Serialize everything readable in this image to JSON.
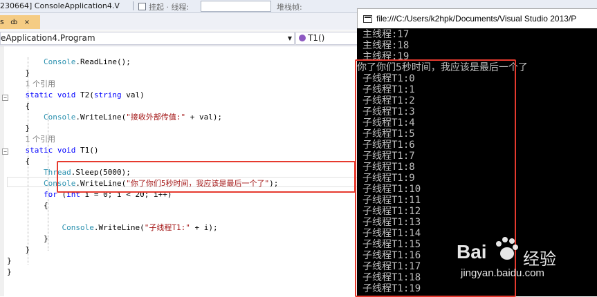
{
  "toolbar": {
    "project_combo": "230664] ConsoleApplication4.V",
    "threads_label": "挂起 · 线程:",
    "stack_frame_label": "堆栈帧:"
  },
  "tab": {
    "label": "s",
    "pin": "ȸ",
    "close": "×"
  },
  "nav": {
    "class_combo": "eApplication4.Program",
    "method_combo": "T1()"
  },
  "code": {
    "lines": [
      {
        "id": "l1",
        "indent": "        ",
        "parts": [
          [
            "ty",
            "Console"
          ],
          [
            "",
            ".ReadLine();"
          ]
        ]
      },
      {
        "id": "l2",
        "indent": "    ",
        "parts": [
          [
            "",
            "}"
          ]
        ]
      },
      {
        "id": "l3",
        "indent": "    ",
        "ref": "1 个引用"
      },
      {
        "id": "l4",
        "indent": "    ",
        "parts": [
          [
            "kw",
            "static"
          ],
          [
            "",
            " "
          ],
          [
            "kw",
            "void"
          ],
          [
            "",
            " T2("
          ],
          [
            "kw",
            "string"
          ],
          [
            "",
            " val)"
          ]
        ]
      },
      {
        "id": "l5",
        "indent": "    ",
        "parts": [
          [
            "",
            "{"
          ]
        ]
      },
      {
        "id": "l6",
        "indent": "        ",
        "parts": [
          [
            "ty",
            "Console"
          ],
          [
            "",
            ".WriteLine("
          ],
          [
            "str",
            "\"接收外部传值:\""
          ],
          [
            "",
            " + val);"
          ]
        ]
      },
      {
        "id": "l7",
        "indent": "    ",
        "parts": [
          [
            "",
            "}"
          ]
        ]
      },
      {
        "id": "l8",
        "indent": "    ",
        "ref": "1 个引用"
      },
      {
        "id": "l9",
        "indent": "    ",
        "parts": [
          [
            "kw",
            "static"
          ],
          [
            "",
            " "
          ],
          [
            "kw",
            "void"
          ],
          [
            "",
            " T1()"
          ]
        ]
      },
      {
        "id": "l10",
        "indent": "    ",
        "parts": [
          [
            "",
            "{"
          ]
        ]
      },
      {
        "id": "l11",
        "indent": "        ",
        "parts": [
          [
            "ty",
            "Thread"
          ],
          [
            "",
            ".Sleep(5000);"
          ]
        ]
      },
      {
        "id": "l12",
        "indent": "        ",
        "parts": [
          [
            "ty",
            "Console"
          ],
          [
            "",
            ".WriteLine("
          ],
          [
            "str",
            "\"你了你们5秒时间，我应该是最后一个了\""
          ],
          [
            "",
            ");"
          ]
        ]
      },
      {
        "id": "l13",
        "indent": "        ",
        "parts": [
          [
            "kw",
            "for"
          ],
          [
            "",
            " ("
          ],
          [
            "kw",
            "int"
          ],
          [
            "",
            " i = 0; i < 20; i++)"
          ]
        ]
      },
      {
        "id": "l14",
        "indent": "        ",
        "parts": [
          [
            "",
            "{"
          ]
        ]
      },
      {
        "id": "l15",
        "indent": "",
        "parts": []
      },
      {
        "id": "l16",
        "indent": "            ",
        "parts": [
          [
            "ty",
            "Console"
          ],
          [
            "",
            ".WriteLine("
          ],
          [
            "str",
            "\"子线程T1:\""
          ],
          [
            "",
            " + i);"
          ]
        ]
      },
      {
        "id": "l17",
        "indent": "        ",
        "parts": [
          [
            "",
            "}"
          ]
        ]
      },
      {
        "id": "l18",
        "indent": "    ",
        "parts": [
          [
            "",
            "}"
          ]
        ]
      },
      {
        "id": "l19",
        "indent": "",
        "parts": [
          [
            "",
            "}"
          ]
        ]
      },
      {
        "id": "l20",
        "indent": "",
        "parts": [
          [
            "",
            "}"
          ]
        ]
      }
    ]
  },
  "console": {
    "title": "file:///C:/Users/k2hpk/Documents/Visual Studio 2013/P",
    "lines": [
      "主线程:17",
      "主线程:18",
      "主线程:19",
      "你了你们5秒时间，我应该是最后一个了",
      "子线程T1:0",
      "子线程T1:1",
      "子线程T1:2",
      "子线程T1:3",
      "子线程T1:4",
      "子线程T1:5",
      "子线程T1:6",
      "子线程T1:7",
      "子线程T1:8",
      "子线程T1:9",
      "子线程T1:10",
      "子线程T1:11",
      "子线程T1:12",
      "子线程T1:13",
      "子线程T1:14",
      "子线程T1:15",
      "子线程T1:16",
      "子线程T1:17",
      "子线程T1:18",
      "子线程T1:19"
    ]
  },
  "watermark": {
    "logo_text": "Bai",
    "logo_text2": "经验",
    "url": "jingyan.baidu.com"
  },
  "colors": {
    "highlight_box": "#e63a2e",
    "keyword": "#0000ff",
    "type": "#2b91af",
    "string": "#a31515",
    "console_bg": "#000000",
    "console_text": "#c0c0c0"
  }
}
